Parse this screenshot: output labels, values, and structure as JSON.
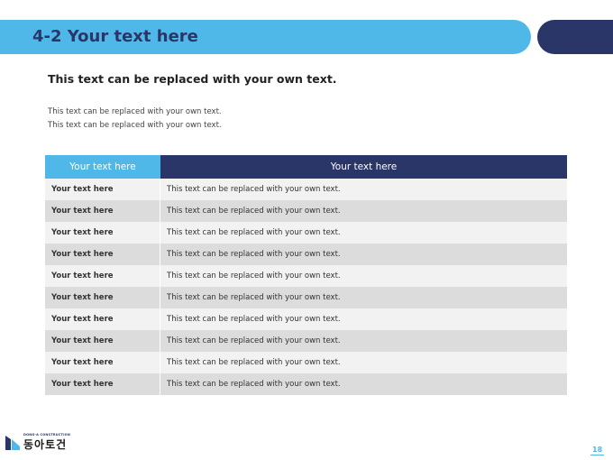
{
  "header": {
    "title": "4-2 Your text here",
    "accent_color": "#4fb8e8",
    "dark_color": "#2b3668"
  },
  "intro": {
    "subtitle": "This text can be replaced with your own text.",
    "lines": [
      "This text can be replaced with your own text.",
      "This text can be replaced with your own text."
    ]
  },
  "table": {
    "headers": [
      "Your text here",
      "Your text here"
    ],
    "rows": [
      [
        "Your text here",
        "This text can be replaced with your own text."
      ],
      [
        "Your text here",
        "This text can be replaced with your own text."
      ],
      [
        "Your text here",
        "This text can be replaced with your own text."
      ],
      [
        "Your text here",
        "This text can be replaced with your own text."
      ],
      [
        "Your text here",
        "This text can be replaced with your own text."
      ],
      [
        "Your text here",
        "This text can be replaced with your own text."
      ],
      [
        "Your text here",
        "This text can be replaced with your own text."
      ],
      [
        "Your text here",
        "This text can be replaced with your own text."
      ],
      [
        "Your text here",
        "This text can be replaced with your own text."
      ],
      [
        "Your text here",
        "This text can be replaced with your own text."
      ]
    ]
  },
  "footer": {
    "logo_small_text": "DONG-A CONSTRUCTION",
    "logo_name": "동아토건",
    "logo_icon": "company-logo-icon",
    "page_number": "18"
  }
}
